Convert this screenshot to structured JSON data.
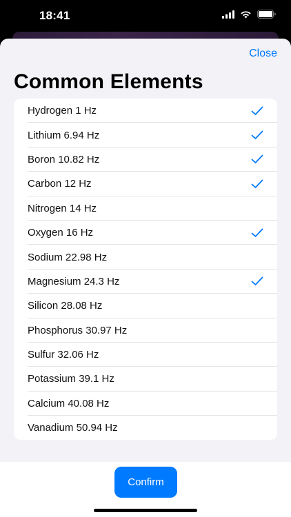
{
  "status_bar": {
    "time": "18:41",
    "icons": [
      "cellular-signal-icon",
      "wifi-icon",
      "battery-icon"
    ]
  },
  "sheet": {
    "close_label": "Close",
    "title": "Common Elements"
  },
  "elements": [
    {
      "label": "Hydrogen 1 Hz",
      "checked": true
    },
    {
      "label": "Lithium 6.94 Hz",
      "checked": true
    },
    {
      "label": "Boron 10.82 Hz",
      "checked": true
    },
    {
      "label": "Carbon 12 Hz",
      "checked": true
    },
    {
      "label": "Nitrogen 14 Hz",
      "checked": false
    },
    {
      "label": "Oxygen 16 Hz",
      "checked": true
    },
    {
      "label": "Sodium 22.98 Hz",
      "checked": false
    },
    {
      "label": "Magnesium 24.3 Hz",
      "checked": true
    },
    {
      "label": "Silicon 28.08 Hz",
      "checked": false
    },
    {
      "label": "Phosphorus 30.97 Hz",
      "checked": false
    },
    {
      "label": "Sulfur 32.06 Hz",
      "checked": false
    },
    {
      "label": "Potassium 39.1 Hz",
      "checked": false
    },
    {
      "label": "Calcium 40.08 Hz",
      "checked": false
    },
    {
      "label": "Vanadium 50.94 Hz",
      "checked": false
    }
  ],
  "footer": {
    "confirm_label": "Confirm"
  },
  "colors": {
    "accent": "#007aff",
    "sheet_background": "#f2f2f7",
    "list_background": "#ffffff"
  }
}
